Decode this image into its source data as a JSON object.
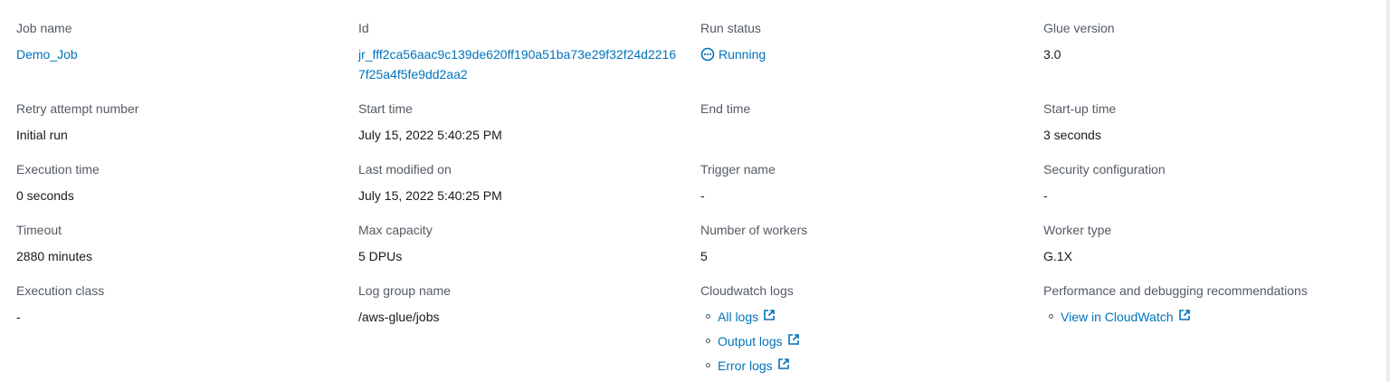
{
  "fields": {
    "job_name": {
      "label": "Job name",
      "value": "Demo_Job"
    },
    "id": {
      "label": "Id",
      "value": "jr_fff2ca56aac9c139de620ff190a51ba73e29f32f24d22167f25a4f5fe9dd2aa2"
    },
    "run_status": {
      "label": "Run status",
      "value": "Running"
    },
    "glue_version": {
      "label": "Glue version",
      "value": "3.0"
    },
    "retry_attempt": {
      "label": "Retry attempt number",
      "value": "Initial run"
    },
    "start_time": {
      "label": "Start time",
      "value": "July 15, 2022 5:40:25 PM"
    },
    "end_time": {
      "label": "End time",
      "value": ""
    },
    "startup_time": {
      "label": "Start-up time",
      "value": "3 seconds"
    },
    "execution_time": {
      "label": "Execution time",
      "value": "0 seconds"
    },
    "last_modified": {
      "label": "Last modified on",
      "value": "July 15, 2022 5:40:25 PM"
    },
    "trigger_name": {
      "label": "Trigger name",
      "value": "-"
    },
    "security_config": {
      "label": "Security configuration",
      "value": "-"
    },
    "timeout": {
      "label": "Timeout",
      "value": "2880 minutes"
    },
    "max_capacity": {
      "label": "Max capacity",
      "value": "5 DPUs"
    },
    "num_workers": {
      "label": "Number of workers",
      "value": "5"
    },
    "worker_type": {
      "label": "Worker type",
      "value": "G.1X"
    },
    "execution_class": {
      "label": "Execution class",
      "value": "-"
    },
    "log_group": {
      "label": "Log group name",
      "value": "/aws-glue/jobs"
    },
    "cloudwatch_logs": {
      "label": "Cloudwatch logs",
      "links": [
        "All logs",
        "Output logs",
        "Error logs"
      ]
    },
    "perf_debug": {
      "label": "Performance and debugging recommendations",
      "links": [
        "View in CloudWatch"
      ]
    }
  },
  "icons": {
    "status": "in-progress-icon",
    "external": "external-link-icon"
  },
  "colors": {
    "link": "#0073bb",
    "label": "#545b64",
    "text": "#16191f"
  }
}
